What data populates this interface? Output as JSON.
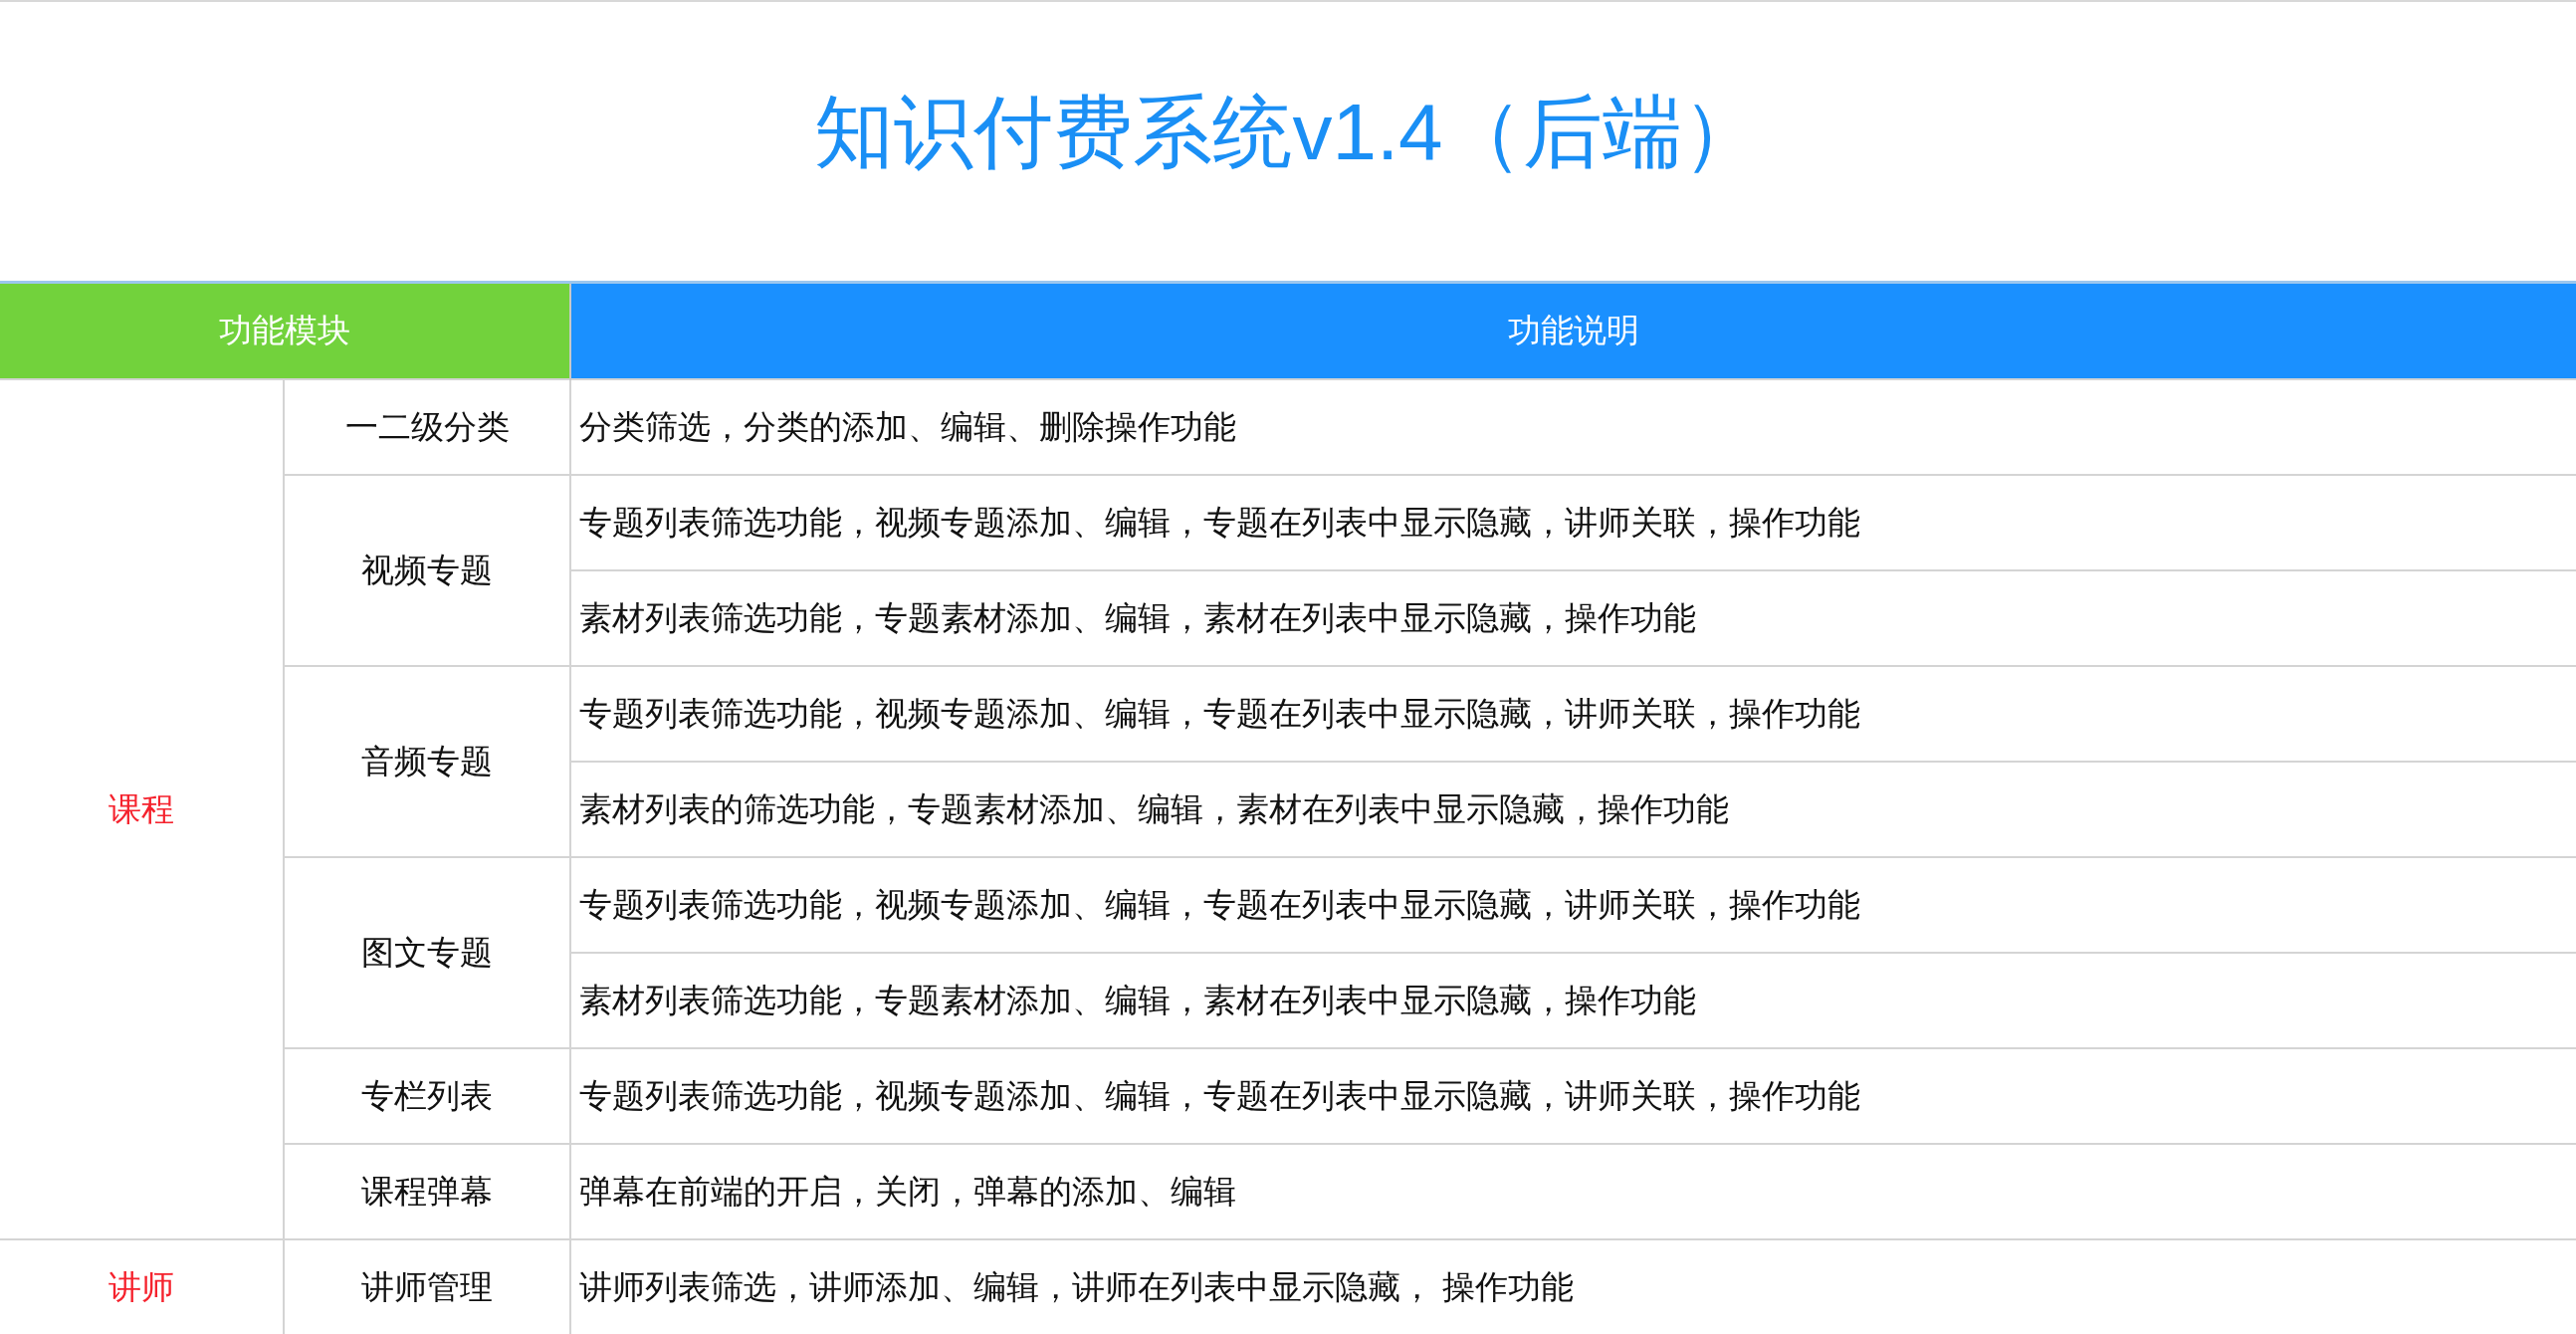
{
  "title": "知识付费系统v1.4（后端）",
  "columns": [
    "功能模块",
    "功能说明"
  ],
  "modules": [
    {
      "name": "课程",
      "subs": [
        {
          "name": "一二级分类",
          "items": [
            "分类筛选，分类的添加、编辑、删除操作功能"
          ]
        },
        {
          "name": "视频专题",
          "items": [
            "专题列表筛选功能，视频专题添加、编辑，专题在列表中显示隐藏，讲师关联，操作功能",
            "素材列表筛选功能，专题素材添加、编辑，素材在列表中显示隐藏，操作功能"
          ]
        },
        {
          "name": "音频专题",
          "items": [
            "专题列表筛选功能，视频专题添加、编辑，专题在列表中显示隐藏，讲师关联，操作功能",
            "素材列表的筛选功能，专题素材添加、编辑，素材在列表中显示隐藏，操作功能"
          ]
        },
        {
          "name": "图文专题",
          "items": [
            "专题列表筛选功能，视频专题添加、编辑，专题在列表中显示隐藏，讲师关联，操作功能",
            "素材列表筛选功能，专题素材添加、编辑，素材在列表中显示隐藏，操作功能"
          ]
        },
        {
          "name": "专栏列表",
          "items": [
            "专题列表筛选功能，视频专题添加、编辑，专题在列表中显示隐藏，讲师关联，操作功能"
          ]
        },
        {
          "name": "课程弹幕",
          "items": [
            "弹幕在前端的开启，关闭，弹幕的添加、编辑"
          ]
        }
      ]
    },
    {
      "name": "讲师",
      "subs": [
        {
          "name": "讲师管理",
          "items": [
            "讲师列表筛选，讲师添加、编辑，讲师在列表中显示隐藏， 操作功能"
          ]
        }
      ]
    }
  ]
}
